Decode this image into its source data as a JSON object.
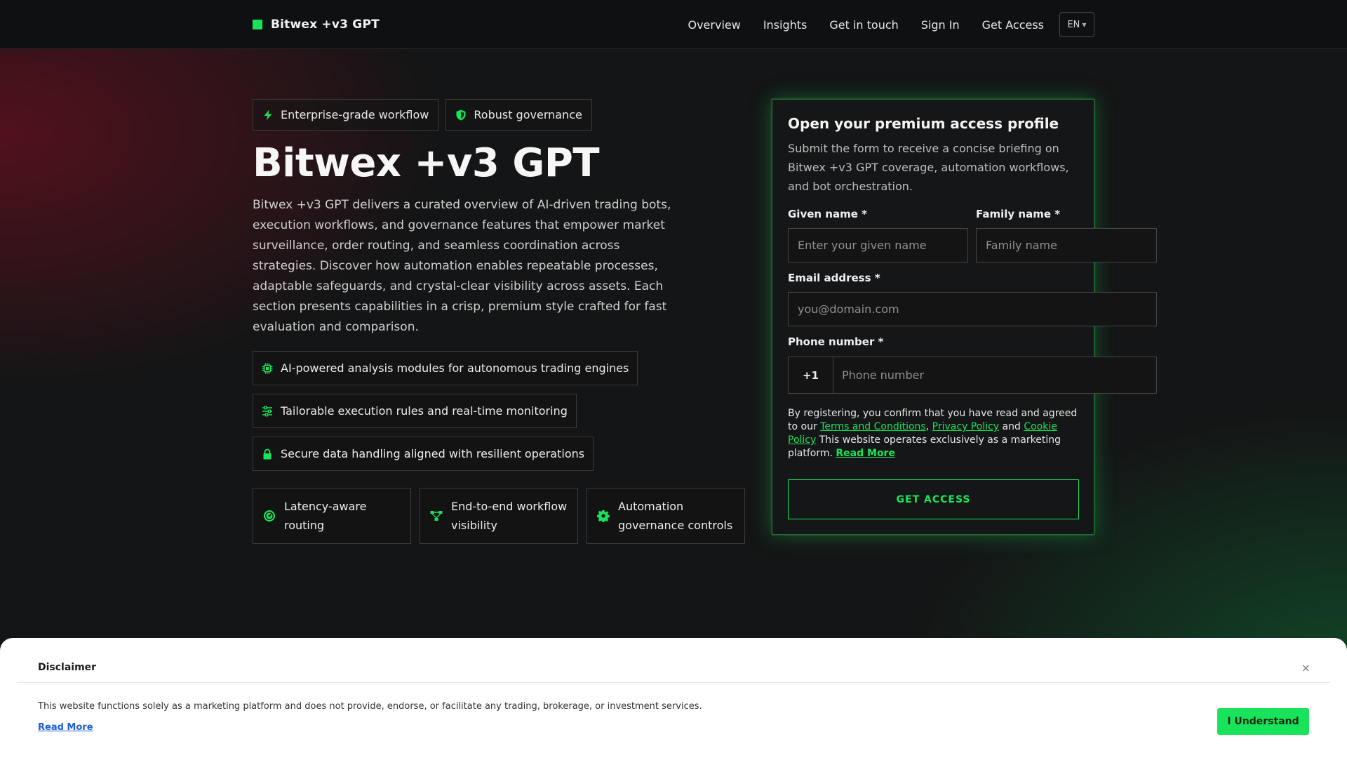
{
  "header": {
    "brand": "Bitwex +v3 GPT",
    "nav": [
      "Overview",
      "Insights",
      "Get in touch",
      "Sign In",
      "Get Access"
    ],
    "language": "EN"
  },
  "hero": {
    "chips": [
      "Enterprise-grade workflow",
      "Robust governance"
    ],
    "title": "Bitwex +v3 GPT",
    "description": "Bitwex +v3 GPT delivers a curated overview of AI-driven trading bots, execution workflows, and governance features that empower market surveillance, order routing, and seamless coordination across strategies. Discover how automation enables repeatable processes, adaptable safeguards, and crystal-clear visibility across assets. Each section presents capabilities in a crisp, premium style crafted for fast evaluation and comparison.",
    "features": [
      "AI-powered analysis modules for autonomous trading engines",
      "Tailorable execution rules and real-time monitoring",
      "Secure data handling aligned with resilient operations"
    ],
    "cards": [
      "Latency-aware routing",
      "End-to-end workflow visibility",
      "Automation governance controls"
    ]
  },
  "form": {
    "title": "Open your premium access profile",
    "description": "Submit the form to receive a concise briefing on Bitwex +v3 GPT coverage, automation workflows, and bot orchestration.",
    "given_label": "Given name *",
    "given_placeholder": "Enter your given name",
    "family_label": "Family name *",
    "family_placeholder": "Family name",
    "email_label": "Email address *",
    "email_placeholder": "you@domain.com",
    "phone_label": "Phone number *",
    "phone_code": "+1",
    "phone_placeholder": "Phone number",
    "legal_prefix": "By registering, you confirm that you have read and agreed to our",
    "terms": "Terms and Conditions",
    "privacy": "Privacy Policy",
    "and": "and",
    "cookie": "Cookie Policy",
    "legal_suffix": "This website operates exclusively as a marketing platform.",
    "read_more": "Read More",
    "cta": "GET ACCESS"
  },
  "disclaimer": {
    "title": "Disclaimer",
    "close": "×",
    "text": "This website functions solely as a marketing platform and does not provide, endorse, or facilitate any trading, brokerage, or investment services.",
    "read_more": "Read More",
    "button": "I Understand"
  },
  "colors": {
    "accent": "#19e35a",
    "background": "#141516",
    "link_blue": "#1a5fd6"
  },
  "icons": {
    "chip_0": "lightning-icon",
    "chip_1": "shield-icon",
    "feature_0": "chip-icon",
    "feature_1": "sliders-icon",
    "feature_2": "lock-icon",
    "card_0": "gauge-icon",
    "card_1": "workflow-icon",
    "card_2": "gear-icon"
  }
}
